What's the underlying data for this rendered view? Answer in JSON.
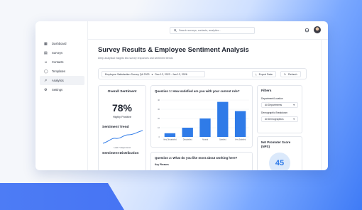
{
  "sidebar": {
    "items": [
      {
        "label": "Dashboard",
        "icon": "dashboard-icon"
      },
      {
        "label": "Surveys",
        "icon": "clipboard-icon"
      },
      {
        "label": "Contacts",
        "icon": "users-icon"
      },
      {
        "label": "Templates",
        "icon": "chat-icon"
      },
      {
        "label": "Analytics",
        "icon": "analytics-icon"
      },
      {
        "label": "Settings",
        "icon": "gear-icon"
      }
    ],
    "active_index": 4
  },
  "header": {
    "search_placeholder": "Search surveys, contacts, analytics..."
  },
  "page": {
    "title": "Survey Results & Employee Sentiment Analysis",
    "subtitle": "Deep analytical insights into survey responses and sentiment trends"
  },
  "filters_bar": {
    "survey": "Employee Satisfaction Survey Q4 2023",
    "date_range": "Dec 12, 2023 - Jan 12, 2026",
    "export_label": "Export Data",
    "refresh_label": "Refresh"
  },
  "sentiment": {
    "title": "Overall Sentiment",
    "percent": "78%",
    "label": "Highly Positive",
    "trend_title": "Sentiment Trend",
    "trend_caption": "Last 7 days trend",
    "distribution_title": "Sentiment Distribution"
  },
  "question1": {
    "title": "Question 1: How satisfied are you with your current role?"
  },
  "question2": {
    "title": "Question 2: What do you like most about working here?",
    "subtitle": "Key Phrases"
  },
  "filters_panel": {
    "title": "Filters",
    "department_label": "Department/Location",
    "department_value": "All Departments",
    "demographic_label": "Demographic Breakdown",
    "demographic_value": "All Demographics"
  },
  "nps": {
    "title": "Net Promoter Score (NPS)",
    "value": "45"
  },
  "colors": {
    "accent": "#2f7be8",
    "nps_ring": "#dbe9fb"
  },
  "chart_data": {
    "type": "bar",
    "categories": [
      "Very Dissatisfied",
      "Dissatisfied",
      "Neutral",
      "Satisfied",
      "Very Satisfied"
    ],
    "values": [
      4,
      10,
      20,
      38,
      28
    ],
    "ylim": [
      0,
      40
    ],
    "yticks": [
      0,
      10,
      20,
      30,
      40
    ],
    "xlabel": "",
    "ylabel": "",
    "grid": true
  }
}
